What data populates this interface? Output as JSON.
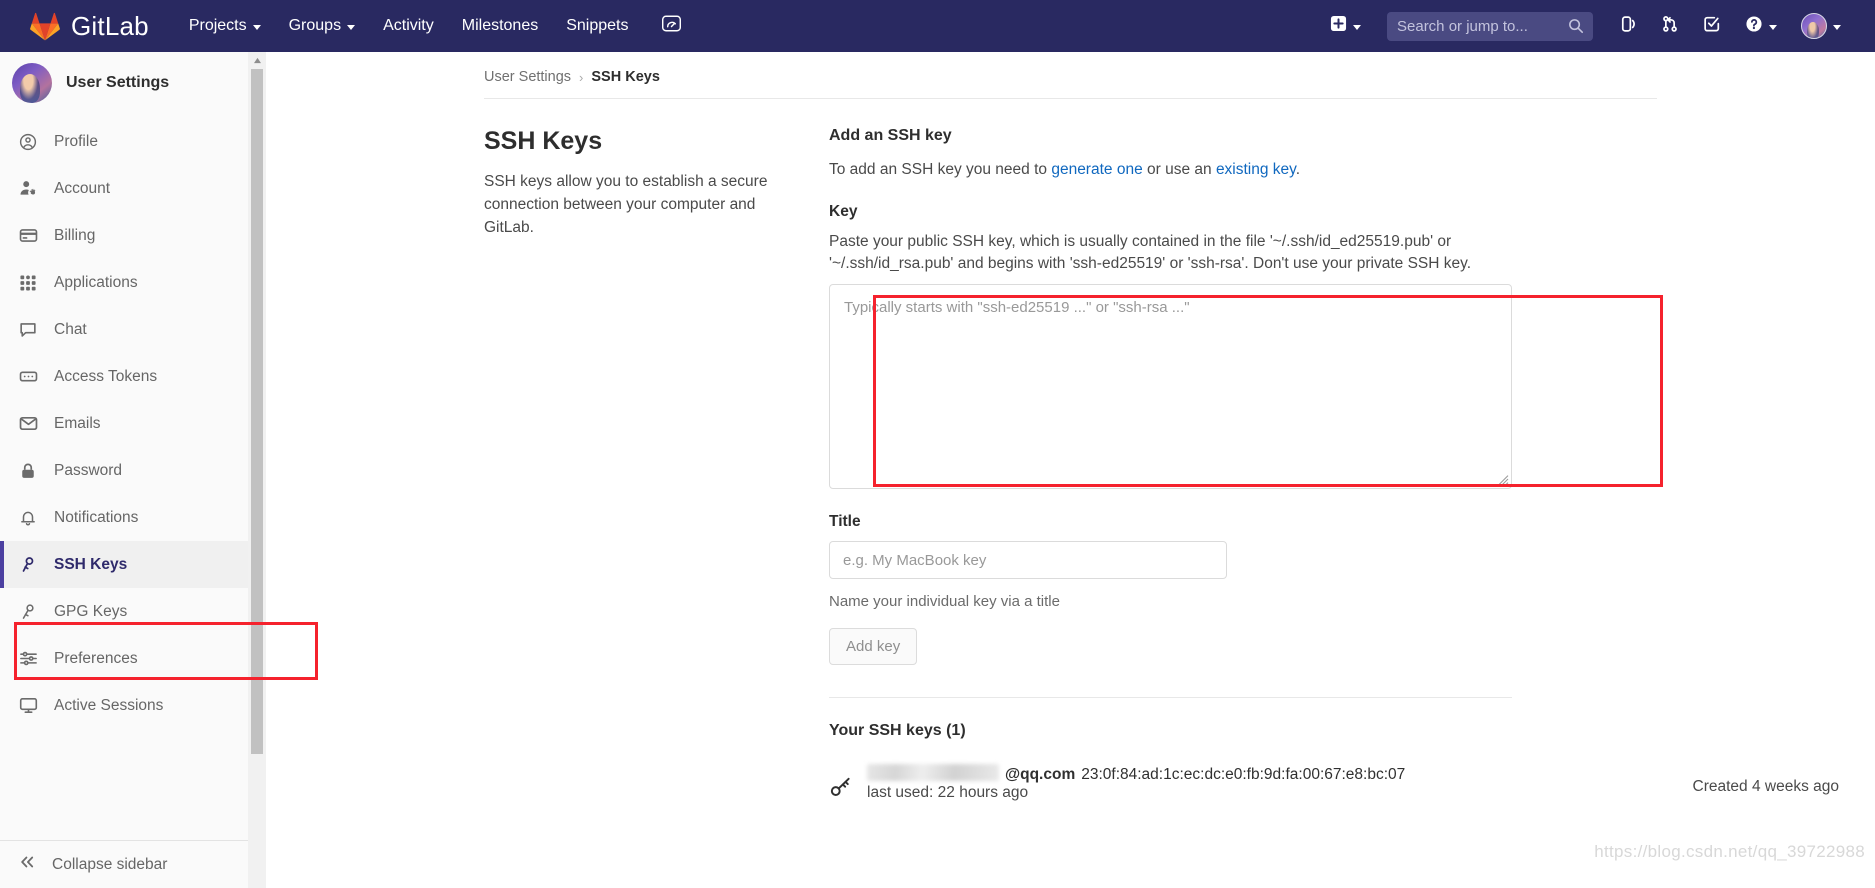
{
  "navbar": {
    "brand": "GitLab",
    "brand_icon": "gitlab-logo-icon",
    "links": [
      {
        "label": "Projects",
        "icon": "chevron-down-icon",
        "has_caret": true
      },
      {
        "label": "Groups",
        "icon": "chevron-down-icon",
        "has_caret": true
      },
      {
        "label": "Activity",
        "has_caret": false
      },
      {
        "label": "Milestones",
        "has_caret": false
      },
      {
        "label": "Snippets",
        "has_caret": false
      }
    ],
    "dashboard_icon": "speedometer-icon",
    "create_new_icon": "plus-square-icon",
    "create_new_caret": "chevron-down-icon",
    "search": {
      "placeholder": "Search or jump to...",
      "value": "",
      "icon": "search-icon"
    },
    "right_icons": [
      {
        "name": "issues-icon"
      },
      {
        "name": "merge-requests-icon"
      },
      {
        "name": "todos-icon"
      },
      {
        "name": "help-icon",
        "caret": true
      }
    ],
    "avatar_icon": "user-avatar",
    "avatar_caret": "chevron-down-icon",
    "bg_color": "#292961"
  },
  "sidebar": {
    "title": "User Settings",
    "avatar_icon": "user-avatar",
    "items": [
      {
        "label": "Profile",
        "icon": "user-circle-icon",
        "active": false
      },
      {
        "label": "Account",
        "icon": "user-gear-icon",
        "active": false
      },
      {
        "label": "Billing",
        "icon": "credit-card-icon",
        "active": false
      },
      {
        "label": "Applications",
        "icon": "grid-apps-icon",
        "active": false
      },
      {
        "label": "Chat",
        "icon": "chat-bubble-icon",
        "active": false
      },
      {
        "label": "Access Tokens",
        "icon": "token-icon",
        "active": false
      },
      {
        "label": "Emails",
        "icon": "envelope-icon",
        "active": false
      },
      {
        "label": "Password",
        "icon": "lock-icon",
        "active": false
      },
      {
        "label": "Notifications",
        "icon": "bell-icon",
        "active": false
      },
      {
        "label": "SSH Keys",
        "icon": "key-icon",
        "active": true
      },
      {
        "label": "GPG Keys",
        "icon": "key-outline-icon",
        "active": false
      },
      {
        "label": "Preferences",
        "icon": "sliders-icon",
        "active": false
      },
      {
        "label": "Active Sessions",
        "icon": "monitor-icon",
        "active": false
      }
    ],
    "collapse": {
      "label": "Collapse sidebar",
      "icon": "chevron-double-left-icon"
    },
    "scrollbar": {
      "up_arrow_icon": "scroll-up-arrow-icon"
    }
  },
  "breadcrumb": {
    "parent": "User Settings",
    "separator": "›",
    "current": "SSH Keys"
  },
  "page": {
    "title": "SSH Keys",
    "description": "SSH keys allow you to establish a secure connection between your computer and GitLab."
  },
  "add_key": {
    "heading": "Add an SSH key",
    "desc_prefix": "To add an SSH key you need to ",
    "link_generate": "generate one",
    "desc_middle": " or use an ",
    "link_existing": "existing key",
    "desc_suffix": ".",
    "key_label": "Key",
    "key_help": "Paste your public SSH key, which is usually contained in the file '~/.ssh/id_ed25519.pub' or '~/.ssh/id_rsa.pub' and begins with 'ssh-ed25519' or 'ssh-rsa'. Don't use your private SSH key.",
    "key_placeholder": "Typically starts with \"ssh-ed25519 ...\" or \"ssh-rsa ...\"",
    "key_value": "",
    "title_label": "Title",
    "title_placeholder": "e.g. My MacBook key",
    "title_value": "",
    "title_help": "Name your individual key via a title",
    "submit_label": "Add key"
  },
  "keys_list": {
    "heading": "Your SSH keys (1)",
    "rows": [
      {
        "icon": "key-icon",
        "email_redacted": true,
        "email_suffix": "@qq.com",
        "fingerprint": "23:0f:84:ad:1c:ec:dc:e0:fb:9d:fa:00:67:e8:bc:07",
        "last_used": "last used: 22 hours ago",
        "created": "Created 4 weeks ago",
        "delete_icon": "trash-icon"
      }
    ]
  },
  "annotations": [
    {
      "name": "sidebar-ssh-keys-highlight",
      "color": "#f5222d"
    },
    {
      "name": "key-textarea-highlight",
      "color": "#f5222d"
    }
  ],
  "watermark": "https://blog.csdn.net/qq_39722988"
}
